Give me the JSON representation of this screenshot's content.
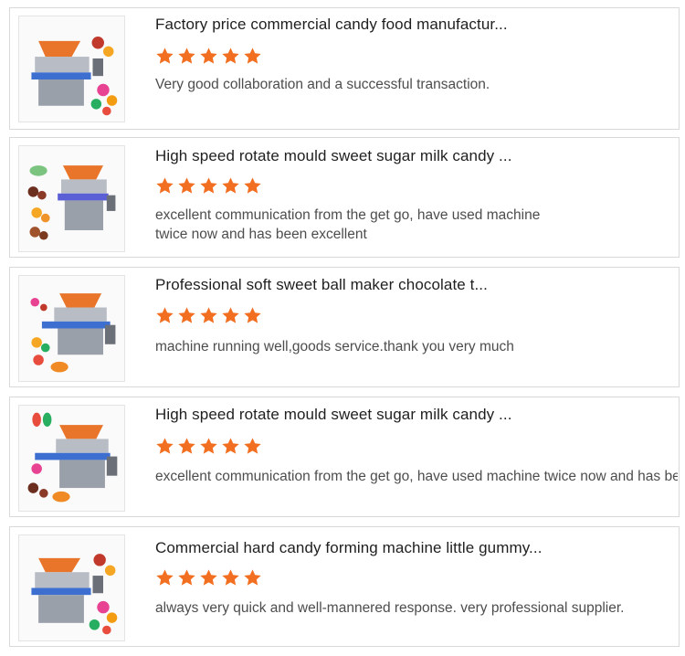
{
  "reviews": [
    {
      "title": "Factory price commercial candy food manufactur...",
      "rating": 5,
      "text": "Very good collaboration and a successful transaction."
    },
    {
      "title": "High speed rotate mould sweet sugar milk candy ...",
      "rating": 5,
      "text": "excellent communication from the get go, have used machine twice now and has been excellent"
    },
    {
      "title": "Professional soft sweet ball maker chocolate t...",
      "rating": 5,
      "text": "machine running well,goods service.thank you very much"
    },
    {
      "title": "High speed rotate mould sweet sugar milk candy ...",
      "rating": 5,
      "text": "excellent communication from the get go, have used machine twice now and has been excellent"
    },
    {
      "title": "Commercial hard candy forming machine little gummy...",
      "rating": 5,
      "text": "always very quick and well-mannered response. very professional supplier."
    }
  ],
  "colors": {
    "star": "#f26f21",
    "border": "#d9d9d9",
    "machine_hopper": "#e8752a",
    "belt": "#3d6fd1"
  },
  "icons": {
    "rating": "star-icon",
    "thumbnail": "candy-machine-image"
  }
}
